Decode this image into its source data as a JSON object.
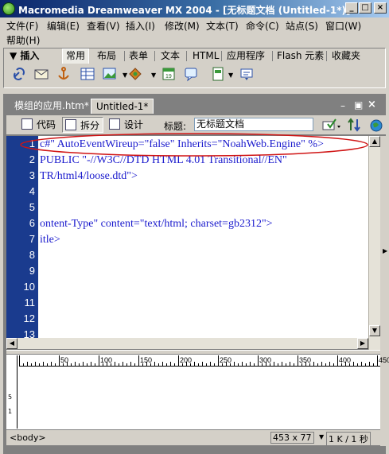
{
  "window": {
    "title": "Macromedia Dreamweaver MX 2004 - [无标题文档 (Untitled-1*)]",
    "controls": [
      "_",
      "□",
      "×"
    ]
  },
  "menu": [
    "文件(F)",
    "编辑(E)",
    "查看(V)",
    "插入(I)",
    "修改(M)",
    "文本(T)",
    "命令(C)",
    "站点(S)",
    "窗口(W)",
    "帮助(H)"
  ],
  "insert_panel": {
    "label": "▼ 插入",
    "tabs": [
      "常用",
      "布局",
      "表单",
      "文本",
      "HTML",
      "应用程序",
      "Flash 元素",
      "收藏夹"
    ],
    "active_tab": "常用",
    "tools": [
      "hyperlink-icon",
      "email-link-icon",
      "named-anchor-icon",
      "table-icon",
      "image-icon",
      "media-icon",
      "date-icon",
      "comment-icon",
      "template-icon",
      "tag-chooser-icon"
    ]
  },
  "document": {
    "tabs": [
      "模组的应用.htm*",
      "Untitled-1*"
    ],
    "active_tab": "Untitled-1*",
    "view_buttons": [
      "代码",
      "拆分",
      "设计"
    ],
    "active_view": "拆分",
    "title_label": "标题:",
    "title_value": "无标题文档"
  },
  "code": {
    "line_numbers": [
      "1",
      "2",
      "3",
      "4",
      "5",
      "6",
      "7",
      "8",
      "9",
      "10",
      "11",
      "12",
      "13"
    ],
    "lines": [
      "c#\" AutoEventWireup=\"false\" Inherits=\"NoahWeb.Engine\" %>",
      "PUBLIC \"-//W3C//DTD HTML 4.01 Transitional//EN\"",
      "TR/html4/loose.dtd\">",
      "",
      "",
      "ontent-Type\" content=\"text/html; charset=gb2312\">",
      "itle>",
      "",
      "",
      "",
      "",
      "",
      ""
    ]
  },
  "ruler": {
    "ticks": [
      "50",
      "100",
      "150",
      "200",
      "250",
      "300",
      "350",
      "400",
      "450"
    ],
    "vticks": [
      "5",
      "1"
    ]
  },
  "status": {
    "tag": "<body>",
    "size": "453 x 77",
    "download": "1 K / 1 秒"
  },
  "colors": {
    "gutter": "#1a3b8e",
    "code_text": "#1a1acd",
    "annotation": "#d01414"
  }
}
